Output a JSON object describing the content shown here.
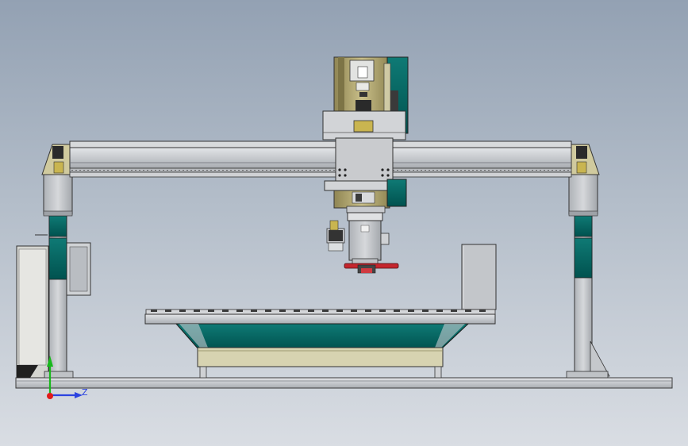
{
  "viewport": {
    "background_top": "#93a1b3",
    "background_bottom": "#d9dde3"
  },
  "colors": {
    "teal": "#006b67",
    "teal_light": "#1a8a84",
    "metal": "#c8cacd",
    "metal_dark": "#8e9296",
    "olive": "#b5ab77",
    "olive_dark": "#7b7146",
    "outline": "#2a2a2a",
    "red": "#c4262e",
    "axis_green": "#19b81c",
    "axis_blue": "#2b43e0",
    "axis_red": "#e21b1b"
  },
  "triad": {
    "axis_label": "Z"
  }
}
